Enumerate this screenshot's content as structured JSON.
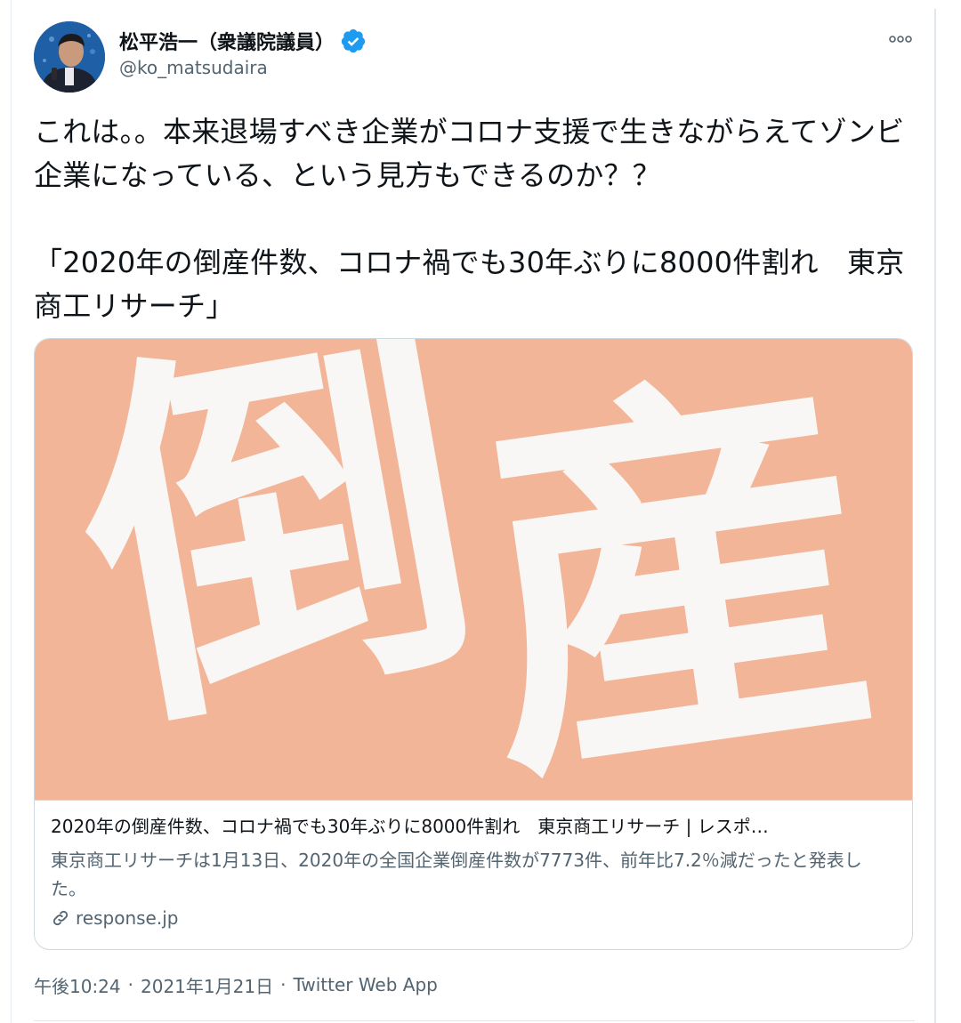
{
  "author": {
    "name": "松平浩一（衆議院議員）",
    "handle": "@ko_matsudaira",
    "verified": true
  },
  "icons": {
    "verified": "verified-badge-icon",
    "more": "more-options-icon",
    "link": "link-icon"
  },
  "tweet": {
    "text": "これは。。本来退場すべき企業がコロナ支援で生きながらえてゾンビ企業になっている、という見方もできるのか？？\n\n「2020年の倒産件数、コロナ禍でも30年ぶりに8000件割れ　東京商工リサーチ」"
  },
  "card": {
    "image_text_1": "倒",
    "image_text_2": "産",
    "title": "2020年の倒産件数、コロナ禍でも30年ぶりに8000件割れ　東京商工リサーチ | レスポ…",
    "description": "東京商工リサーチは1月13日、2020年の全国企業倒産件数が7773件、前年比7.2％減だったと発表した。",
    "domain": "response.jp"
  },
  "meta": {
    "time": "午後10:24",
    "separator": "·",
    "date": "2021年1月21日",
    "source": "Twitter Web App"
  },
  "colors": {
    "verified": "#1d9bf0",
    "secondary_text": "#536471",
    "card_image_bg": "#f2b597",
    "border": "#cfd9de"
  }
}
